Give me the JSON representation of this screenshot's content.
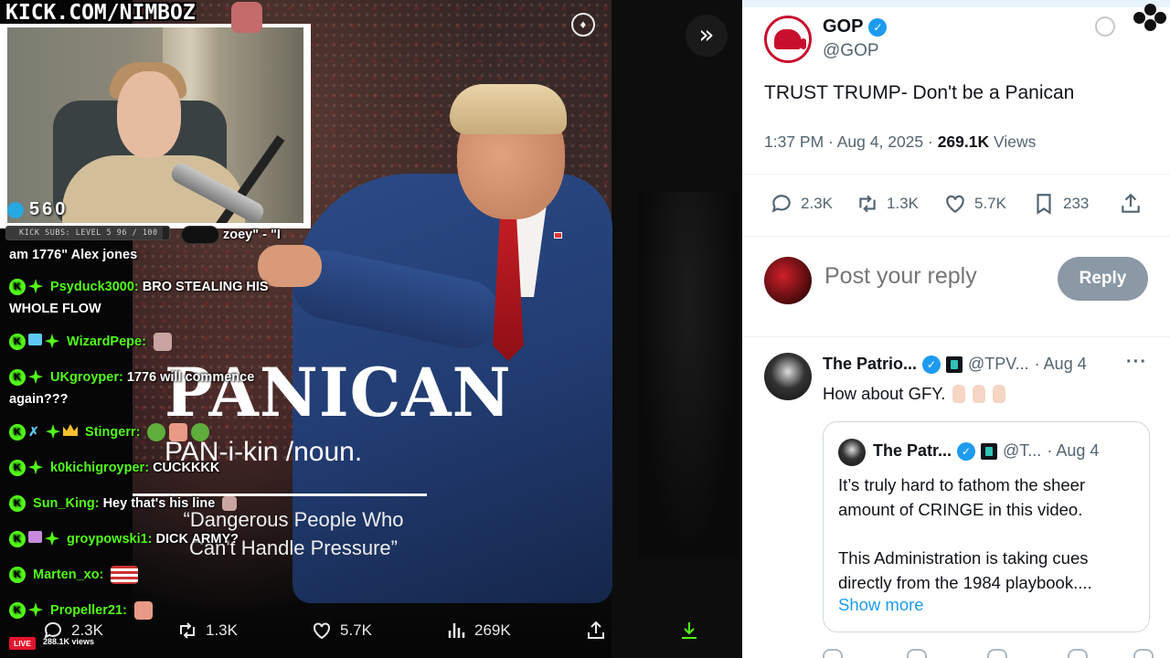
{
  "stream": {
    "channel_url": "KICK.COM/NIMBOZ",
    "viewer_count": "560",
    "subs_goal": "KICK SUBS: LEVEL 5 96 / 100",
    "subs_progress": 0.96,
    "live_label": "LIVE",
    "live_views": "288.1K views"
  },
  "chat": {
    "messages": [
      {
        "user": "",
        "text": "zoey\" - \"I",
        "continuation": "am 1776\" Alex jones"
      },
      {
        "user": "Psyduck3000:",
        "text": "BRO STEALING HIS",
        "continuation": "WHOLE FLOW"
      },
      {
        "user": "WizardPepe:",
        "text": ""
      },
      {
        "user": "UKgroyper:",
        "text": "1776 will commence",
        "continuation": "again???"
      },
      {
        "user": "Stingerr:",
        "text": ""
      },
      {
        "user": "k0kichigroyper:",
        "text": "CUCKKKK"
      },
      {
        "user": "Sun_King:",
        "text": "Hey that's his line"
      },
      {
        "user": "groypowski1:",
        "text": "DICK ARMY?"
      },
      {
        "user": "Marten_xo:",
        "text": ""
      },
      {
        "user": "Propeller21:",
        "text": ""
      }
    ]
  },
  "media": {
    "overlay_title": "PANICAN",
    "overlay_pronunciation": "PAN-i-kin /noun.",
    "overlay_definition": "“Dangerous People Who Can't Handle Pressure”",
    "actions": {
      "replies": "2.3K",
      "reposts": "1.3K",
      "likes": "5.7K",
      "views": "269K"
    }
  },
  "tweet": {
    "author_name": "GOP",
    "author_handle": "@GOP",
    "text": "TRUST TRUMP- Don't be a Panican",
    "time": "1:37 PM · Aug 4, 2025 · ",
    "views_count": "269.1K",
    "views_label": " Views",
    "stats": {
      "replies": "2.3K",
      "reposts": "1.3K",
      "likes": "5.7K",
      "bookmarks": "233"
    },
    "reply_placeholder": "Post your reply",
    "reply_button": "Reply"
  },
  "reply": {
    "name": "The Patrio...",
    "handle": "@TPV...",
    "date": "· Aug 4",
    "text": "How about GFY.",
    "quote": {
      "name": "The Patr...",
      "handle": "@T...",
      "date": "· Aug 4",
      "paragraph1": "It’s truly hard to fathom the sheer amount of CRINGE in this video.",
      "paragraph2": "This Administration is taking cues directly from the 1984 playbook....",
      "show_more": "Show more"
    }
  },
  "colors": {
    "kick_green": "#53fc18",
    "x_blue": "#1d9bf0",
    "gop_red": "#c8102e"
  }
}
